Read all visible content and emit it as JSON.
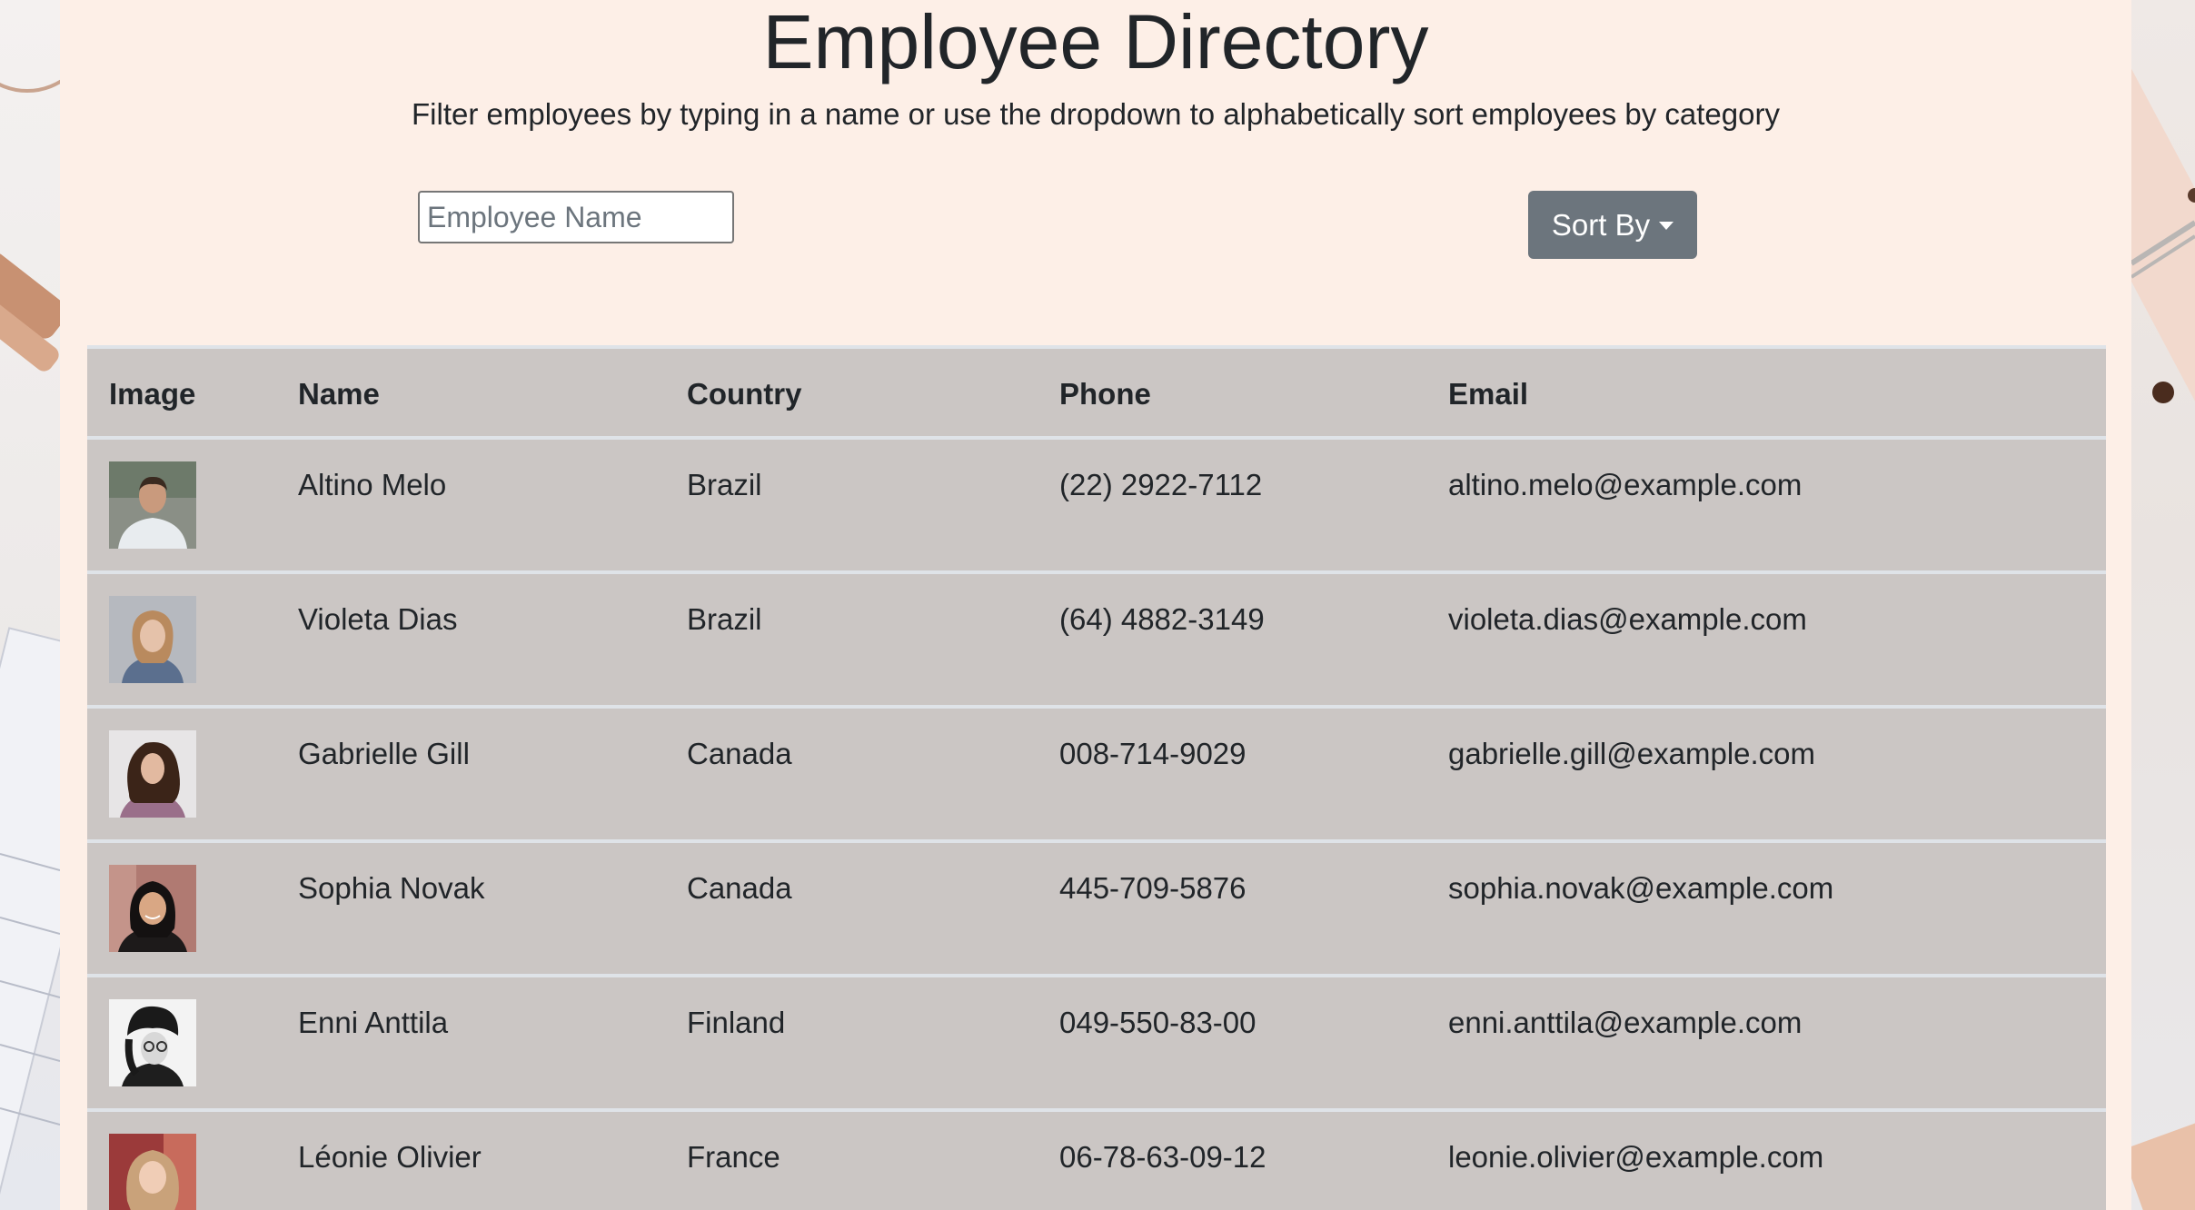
{
  "header": {
    "title": "Employee Directory",
    "subtitle": "Filter employees by typing in a name or use the dropdown to alphabetically sort employees by category"
  },
  "search": {
    "placeholder": "Employee Name",
    "value": ""
  },
  "sort_button": {
    "label": "Sort By"
  },
  "table": {
    "columns": [
      "Image",
      "Name",
      "Country",
      "Phone",
      "Email"
    ],
    "rows": [
      {
        "name": "Altino Melo",
        "country": "Brazil",
        "phone": "(22) 2922-7112",
        "email": "altino.melo@example.com"
      },
      {
        "name": "Violeta Dias",
        "country": "Brazil",
        "phone": "(64) 4882-3149",
        "email": "violeta.dias@example.com"
      },
      {
        "name": "Gabrielle Gill",
        "country": "Canada",
        "phone": "008-714-9029",
        "email": "gabrielle.gill@example.com"
      },
      {
        "name": "Sophia Novak",
        "country": "Canada",
        "phone": "445-709-5876",
        "email": "sophia.novak@example.com"
      },
      {
        "name": "Enni Anttila",
        "country": "Finland",
        "phone": "049-550-83-00",
        "email": "enni.anttila@example.com"
      },
      {
        "name": "Léonie Olivier",
        "country": "France",
        "phone": "06-78-63-09-12",
        "email": "leonie.olivier@example.com"
      }
    ]
  },
  "colors": {
    "panel": "#fdefe7",
    "table_bg": "#cbc6c4",
    "row_divider": "#dfe3e8",
    "button": "#6c757d",
    "text": "#212529"
  }
}
